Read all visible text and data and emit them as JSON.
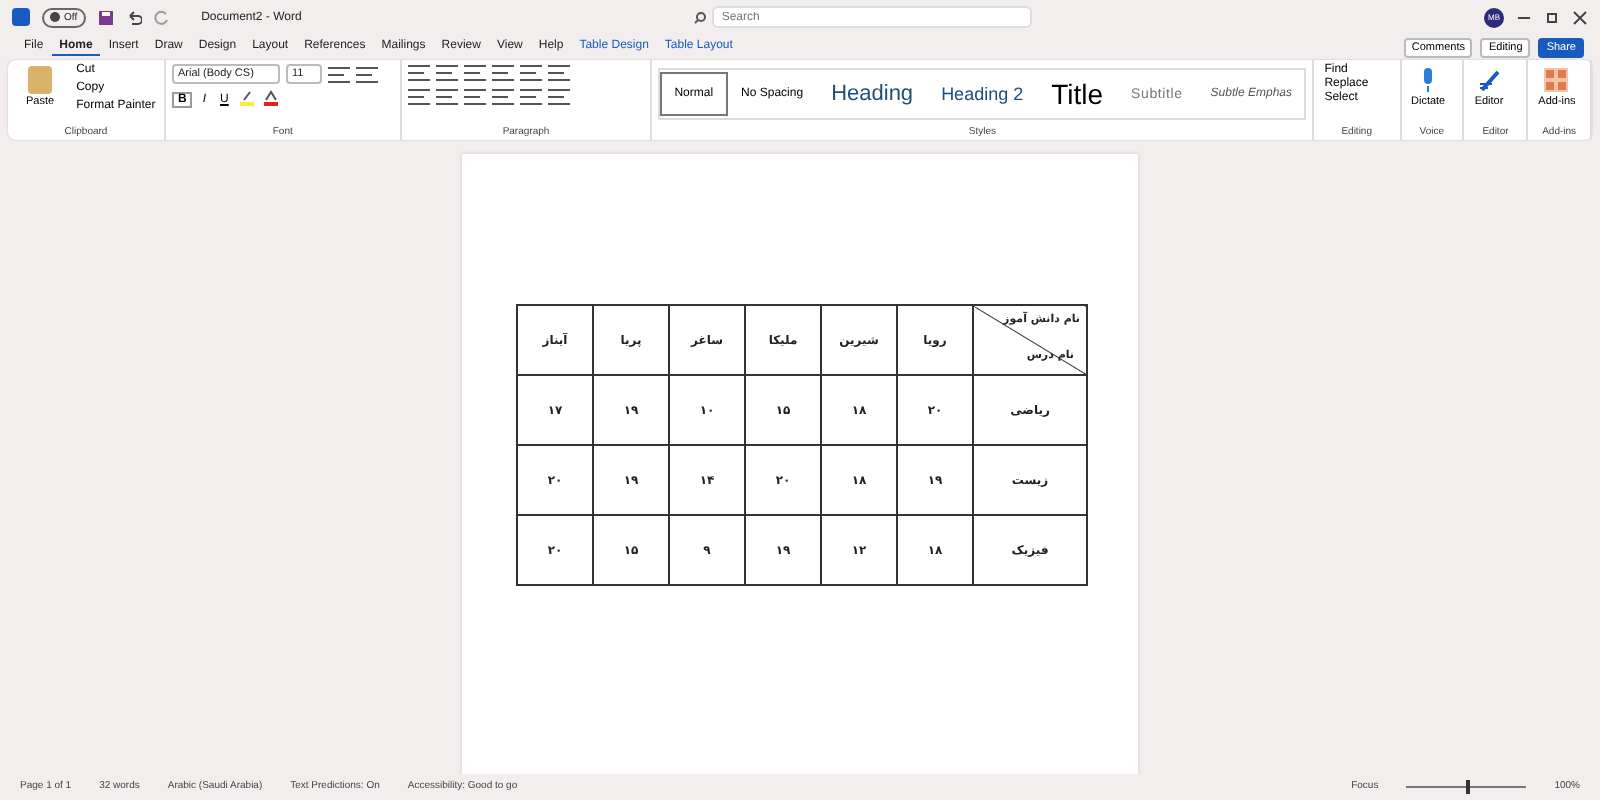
{
  "title_bar": {
    "autosave_state": "Off",
    "autosave_on": false,
    "document_title": "Document2 - Word",
    "search_placeholder": "Search",
    "avatar_initials": "MB"
  },
  "ribbon_tabs": [
    {
      "label": "File",
      "selected": false,
      "kind": "normal"
    },
    {
      "label": "Home",
      "selected": true,
      "kind": "normal"
    },
    {
      "label": "Insert",
      "selected": false,
      "kind": "normal"
    },
    {
      "label": "Draw",
      "selected": false,
      "kind": "normal"
    },
    {
      "label": "Design",
      "selected": false,
      "kind": "normal"
    },
    {
      "label": "Layout",
      "selected": false,
      "kind": "normal"
    },
    {
      "label": "References",
      "selected": false,
      "kind": "normal"
    },
    {
      "label": "Mailings",
      "selected": false,
      "kind": "normal"
    },
    {
      "label": "Review",
      "selected": false,
      "kind": "normal"
    },
    {
      "label": "View",
      "selected": false,
      "kind": "normal"
    },
    {
      "label": "Help",
      "selected": false,
      "kind": "normal"
    },
    {
      "label": "Table Design",
      "selected": false,
      "kind": "contextual"
    },
    {
      "label": "Table Layout",
      "selected": false,
      "kind": "contextual"
    }
  ],
  "action_buttons": [
    {
      "label": "Comments",
      "kind": "plain"
    },
    {
      "label": "Editing",
      "kind": "plain"
    },
    {
      "label": "Share",
      "kind": "primary"
    }
  ],
  "clipboard": {
    "paste": "Paste",
    "commands": [
      "Cut",
      "Copy",
      "Format Painter"
    ],
    "group_label": "Clipboard"
  },
  "font": {
    "font_name": "Arial (Body CS)",
    "font_size": "11",
    "format_keys": [
      "B",
      "I",
      "U"
    ],
    "group_label": "Font"
  },
  "paragraph": {
    "group_label": "Paragraph"
  },
  "styles": {
    "items": [
      {
        "label": "Normal",
        "kind": "normal",
        "selected": true
      },
      {
        "label": "No Spacing",
        "kind": "normal",
        "selected": false
      },
      {
        "label": "Heading",
        "kind": "heading",
        "selected": false
      },
      {
        "label": "Heading 2",
        "kind": "heading2",
        "selected": false
      },
      {
        "label": "Title",
        "kind": "title",
        "selected": false
      },
      {
        "label": "Subtitle",
        "kind": "subtitle",
        "selected": false
      },
      {
        "label": "Subtle Emphas",
        "kind": "emphasis",
        "selected": false
      }
    ],
    "group_label": "Styles"
  },
  "editing": {
    "commands": [
      "Find",
      "Replace",
      "Select"
    ],
    "group_label": "Editing"
  },
  "large_groups": [
    {
      "button": "Dictate",
      "group_label": "Voice",
      "kind": "mic"
    },
    {
      "button": "Editor",
      "group_label": "Editor",
      "kind": "pen"
    },
    {
      "button": "Add-ins",
      "group_label": "Add-ins",
      "kind": "grid"
    }
  ],
  "table": {
    "columns": [
      "آیناز",
      "پریا",
      "ساغر",
      "ملیکا",
      "شیرین",
      "رویا"
    ],
    "corner_top": "نام دانش آموز",
    "corner_bottom": "نام درس",
    "rows": [
      {
        "cells": [
          "۱۷",
          "۱۹",
          "۱۰",
          "۱۵",
          "۱۸",
          "۲۰"
        ],
        "subject": "ریاضی"
      },
      {
        "cells": [
          "۲۰",
          "۱۹",
          "۱۴",
          "۲۰",
          "۱۸",
          "۱۹"
        ],
        "subject": "زیست"
      },
      {
        "cells": [
          "۲۰",
          "۱۵",
          "۹",
          "۱۹",
          "۱۲",
          "۱۸"
        ],
        "subject": "فیزیک"
      }
    ]
  },
  "status_bar": {
    "left": [
      "Page 1 of 1",
      "32 words",
      "Arabic (Saudi Arabia)",
      "Text Predictions: On",
      "Accessibility: Good to go"
    ],
    "focus": "Focus",
    "zoom": {
      "level": 0.5,
      "reading": "100%"
    }
  }
}
